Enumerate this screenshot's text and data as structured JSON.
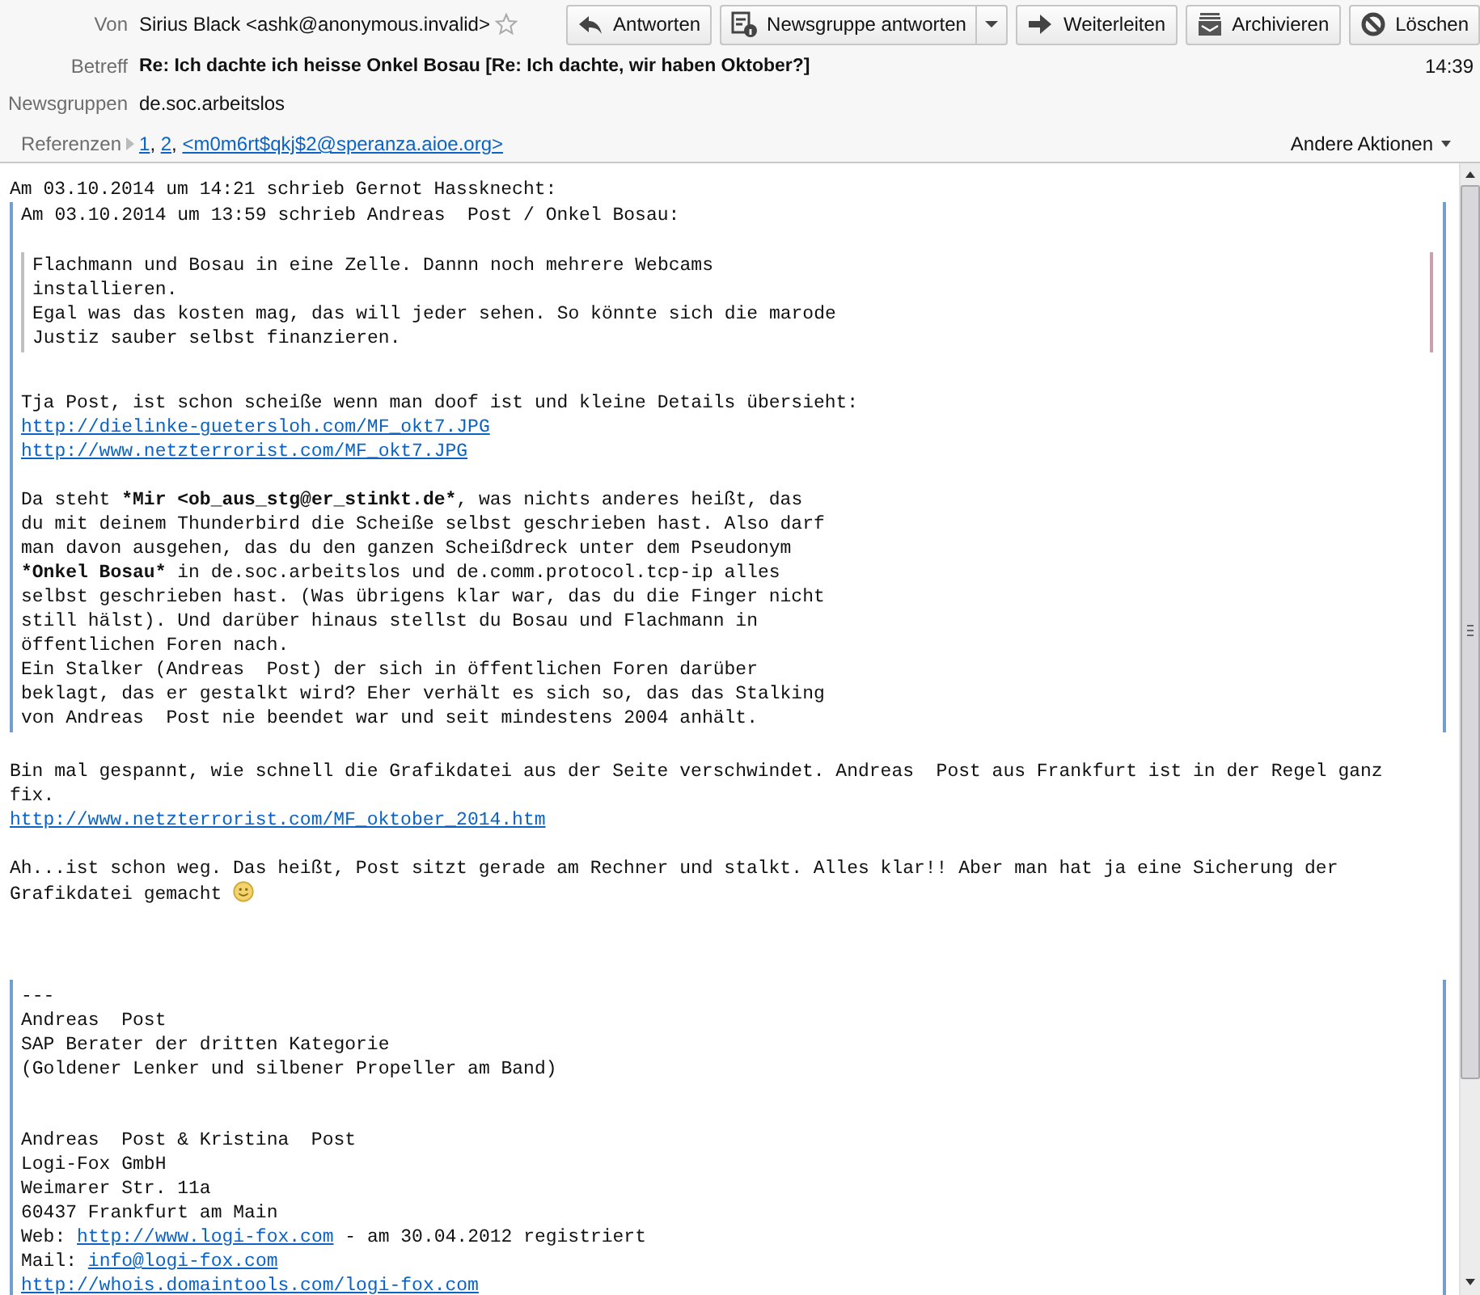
{
  "header": {
    "from": {
      "label": "Von",
      "value": "Sirius Black <ashk@anonymous.invalid>",
      "starred": false
    },
    "buttons": [
      {
        "kind": "reply",
        "label": "Antworten",
        "menu": false
      },
      {
        "kind": "newsgroup",
        "label": "Newsgruppe antworten",
        "menu": true
      },
      {
        "kind": "forward",
        "label": "Weiterleiten",
        "menu": false
      },
      {
        "kind": "archive",
        "label": "Archivieren",
        "menu": false
      },
      {
        "kind": "delete",
        "label": "Löschen",
        "menu": false
      }
    ],
    "subject": {
      "label": "Betreff",
      "value": "Re: Ich dachte ich heisse Onkel Bosau [Re: Ich dachte, wir haben Oktober?]",
      "time": "14:39"
    },
    "newsgroups": {
      "label": "Newsgruppen",
      "value": "de.soc.arbeitslos"
    },
    "references": {
      "label": "Referenzen",
      "expanded": false,
      "separator": ", ",
      "items": [
        "1",
        "2",
        "<m0m6rt$qkj$2@speranza.aioe.org>"
      ]
    },
    "more_actions": "Andere Aktionen"
  },
  "body": [
    {
      "kind": "para",
      "lines": [
        "Am 03.10.2014 um 14:21 schrieb Gernot Hassknecht:"
      ]
    },
    {
      "kind": "quote",
      "children": [
        {
          "kind": "para",
          "lines": [
            "Am 03.10.2014 um 13:59 schrieb Andreas  Post / Onkel Bosau:"
          ]
        },
        {
          "kind": "quote",
          "children": [
            {
              "kind": "para",
              "lines": [
                "Flachmann und Bosau in eine Zelle. Dannn noch mehrere Webcams",
                "installieren.",
                "Egal was das kosten mag, das will jeder sehen. So könnte sich die marode",
                "Justiz sauber selbst finanzieren."
              ]
            }
          ]
        },
        {
          "kind": "para",
          "lines": [
            "Tja Post, ist schon scheiße wenn man doof ist und kleine Details übersieht:",
            [
              {
                "kind": "link",
                "text": "http://dielinke-guetersloh.com/MF_okt7.JPG"
              }
            ],
            [
              {
                "kind": "link",
                "text": "http://www.netzterrorist.com/MF_okt7.JPG"
              }
            ]
          ]
        },
        {
          "kind": "para",
          "lines": [
            [
              {
                "kind": "text",
                "text": "Da steht "
              },
              {
                "kind": "bold",
                "text": "*Mir <ob_aus_stg@er_stinkt.de*"
              },
              {
                "kind": "text",
                "text": ", was nichts anderes heißt, das"
              }
            ],
            "du mit deinem Thunderbird die Scheiße selbst geschrieben hast. Also darf",
            "man davon ausgehen, das du den ganzen Scheißdreck unter dem Pseudonym",
            [
              {
                "kind": "bold",
                "text": "*Onkel Bosau*"
              },
              {
                "kind": "text",
                "text": " in de.soc.arbeitslos und de.comm.protocol.tcp-ip alles"
              }
            ],
            "selbst geschrieben hast. (Was übrigens klar war, das du die Finger nicht",
            "still hälst). Und darüber hinaus stellst du Bosau und Flachmann in",
            "öffentlichen Foren nach.",
            "Ein Stalker (Andreas  Post) der sich in öffentlichen Foren darüber",
            "beklagt, das er gestalkt wird? Eher verhält es sich so, das das Stalking",
            "von Andreas  Post nie beendet war und seit mindestens 2004 anhält."
          ]
        }
      ]
    },
    {
      "kind": "para",
      "lines": [
        "Bin mal gespannt, wie schnell die Grafikdatei aus der Seite verschwindet. Andreas  Post aus Frankfurt ist in der Regel ganz",
        "fix.",
        [
          {
            "kind": "link",
            "text": "http://www.netzterrorist.com/MF_oktober_2014.htm"
          }
        ]
      ]
    },
    {
      "kind": "para",
      "lines": [
        "Ah...ist schon weg. Das heißt, Post sitzt gerade am Rechner und stalkt. Alles klar!! Aber man hat ja eine Sicherung der",
        [
          {
            "kind": "text",
            "text": "Grafikdatei gemacht "
          },
          {
            "kind": "smiley"
          }
        ]
      ]
    },
    {
      "kind": "signature",
      "children": [
        {
          "kind": "para",
          "lines": [
            "---",
            "Andreas  Post",
            "SAP Berater der dritten Kategorie",
            "(Goldener Lenker und silbener Propeller am Band)"
          ]
        },
        {
          "kind": "para",
          "lines": [
            "Andreas  Post & Kristina  Post",
            "Logi-Fox GmbH",
            "Weimarer Str. 11a",
            "60437 Frankfurt am Main",
            [
              {
                "kind": "text",
                "text": "Web: "
              },
              {
                "kind": "link",
                "text": "http://www.logi-fox.com"
              },
              {
                "kind": "text",
                "text": " - am 30.04.2012 registriert"
              }
            ],
            [
              {
                "kind": "text",
                "text": "Mail: "
              },
              {
                "kind": "link",
                "text": "info@logi-fox.com"
              }
            ],
            [
              {
                "kind": "link",
                "text": "http://whois.domaintools.com/logi-fox.com"
              }
            ]
          ]
        }
      ]
    }
  ]
}
